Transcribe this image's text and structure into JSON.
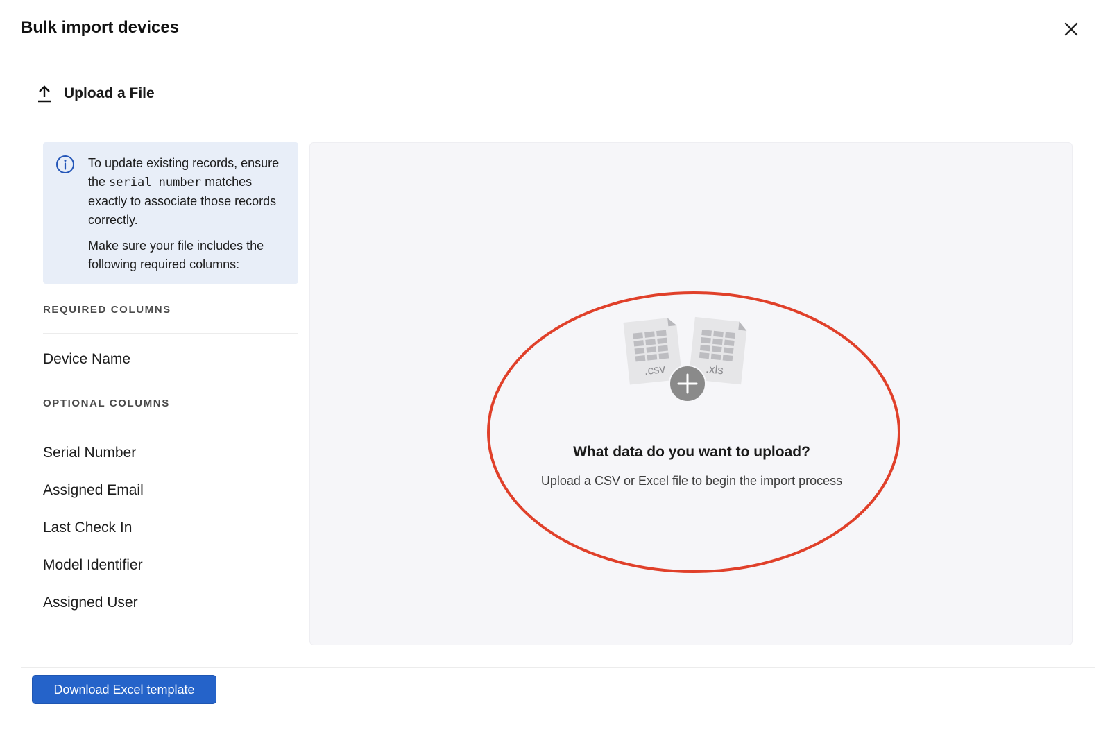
{
  "dialog": {
    "title": "Bulk import devices",
    "close_icon": "close-icon"
  },
  "section": {
    "icon": "upload-icon",
    "label": "Upload a File"
  },
  "info": {
    "icon": "info-icon",
    "line1_before": "To update existing records, ensure the ",
    "line1_code": "serial number",
    "line1_after": " matches exactly to associate those records correctly.",
    "line2": "Make sure your file includes the following required columns:"
  },
  "required": {
    "heading": "REQUIRED COLUMNS",
    "items": [
      "Device Name"
    ]
  },
  "optional": {
    "heading": "OPTIONAL COLUMNS",
    "items": [
      "Serial Number",
      "Assigned Email",
      "Last Check In",
      "Model Identifier",
      "Assigned User"
    ]
  },
  "dropzone": {
    "file_labels": [
      ".csv",
      ".xls"
    ],
    "title": "What data do you want to upload?",
    "subtitle": "Upload a CSV or Excel file to begin the import process"
  },
  "footer": {
    "download_label": "Download Excel template"
  },
  "colors": {
    "primary": "#2563c9",
    "info_bg": "#e8eef8",
    "info_icon": "#2456b8",
    "annotation": "#e0402a",
    "dropzone_bg": "#f6f6f9"
  }
}
